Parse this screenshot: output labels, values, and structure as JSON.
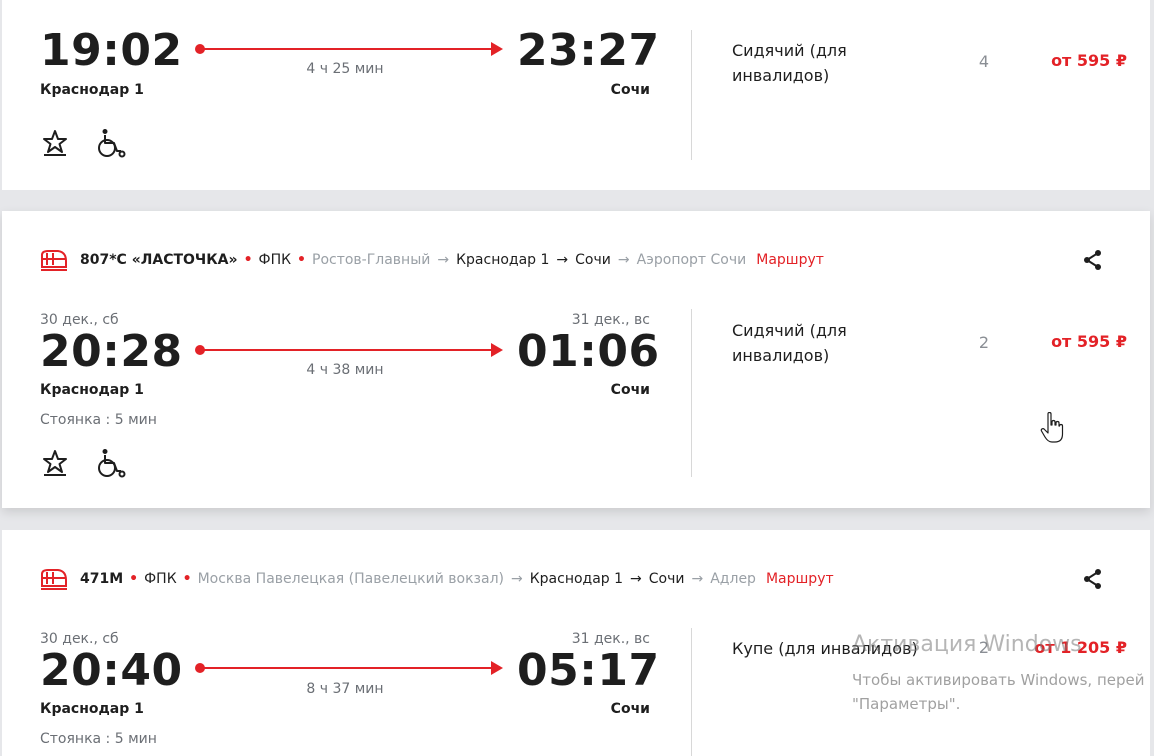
{
  "trips": [
    {
      "header": null,
      "departure": {
        "date": "",
        "time": "19:02",
        "station": "Краснодар 1"
      },
      "arrival": {
        "date": "",
        "time": "23:27",
        "station": "Сочи"
      },
      "duration": "4 ч 25 мин",
      "stop": "",
      "seat": {
        "type": "Сидячий (для инвалидов)",
        "count": "4",
        "price": "от 595 ₽"
      }
    },
    {
      "header": {
        "train": "807*С «ЛАСТОЧКА»",
        "company": "ФПК",
        "route": [
          {
            "name": "Ростов-Главный",
            "active": false
          },
          {
            "name": "Краснодар 1",
            "active": true
          },
          {
            "name": "Сочи",
            "active": true
          },
          {
            "name": "Аэропорт Сочи",
            "active": false
          }
        ],
        "route_link": "Маршрут"
      },
      "departure": {
        "date": "30 дек., сб",
        "time": "20:28",
        "station": "Краснодар 1"
      },
      "arrival": {
        "date": "31 дек., вс",
        "time": "01:06",
        "station": "Сочи"
      },
      "duration": "4 ч 38 мин",
      "stop": "Стоянка : 5 мин",
      "seat": {
        "type": "Сидячий (для инвалидов)",
        "count": "2",
        "price": "от 595 ₽"
      }
    },
    {
      "header": {
        "train": "471М",
        "company": "ФПК",
        "route": [
          {
            "name": "Москва Павелецкая (Павелецкий вокзал)",
            "active": false
          },
          {
            "name": "Краснодар 1",
            "active": true
          },
          {
            "name": "Сочи",
            "active": true
          },
          {
            "name": "Адлер",
            "active": false
          }
        ],
        "route_link": "Маршрут"
      },
      "departure": {
        "date": "30 дек., сб",
        "time": "20:40",
        "station": "Краснодар 1"
      },
      "arrival": {
        "date": "31 дек., вс",
        "time": "05:17",
        "station": "Сочи"
      },
      "duration": "8 ч 37 мин",
      "stop": "Стоянка : 5 мин",
      "seat": {
        "type": "Купе (для инвалидов)",
        "count": "2",
        "price": "от 1 205 ₽"
      }
    }
  ],
  "watermark": {
    "title": "Активация Windows",
    "line1": "Чтобы активировать Windows, перей",
    "line2": "\"Параметры\"."
  },
  "colors": {
    "accent": "#e32227",
    "muted": "#6b6f75",
    "grey_station": "#9aa0a6"
  }
}
